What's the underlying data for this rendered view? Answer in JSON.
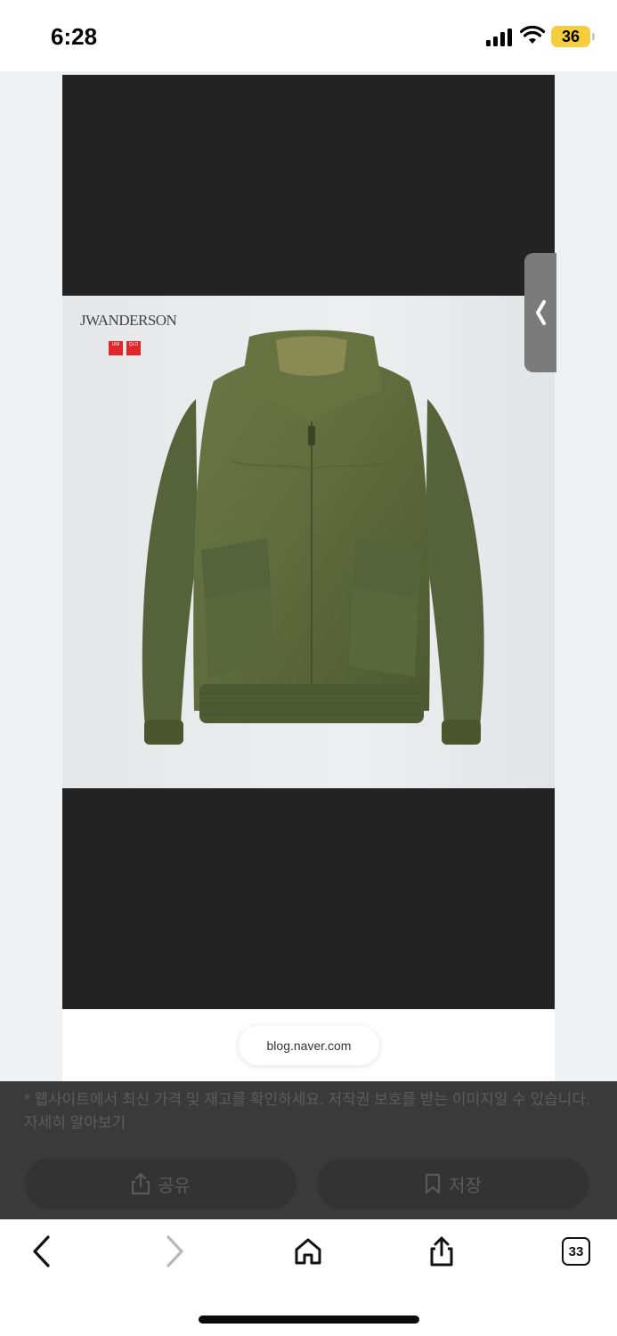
{
  "status": {
    "time": "6:28",
    "battery": "36"
  },
  "viewer": {
    "brand": "JWANDERSON",
    "uniqlo_logo": [
      "UNI",
      "QLO"
    ],
    "source": "blog.naver.com"
  },
  "overlay": {
    "disclaimer": "* 웹사이트에서 최신 가격 및 재고를 확인하세요. 저작권 보호를 받는 이미지일 수 있습니다. 자세히 알아보기",
    "share_label": "공유",
    "save_label": "저장"
  },
  "toolbar": {
    "tabs_count": "33"
  },
  "icons": {
    "back": "chevron-left-icon",
    "forward": "chevron-right-icon",
    "home": "home-icon",
    "share": "share-icon",
    "tabs": "tabs-icon"
  },
  "colors": {
    "battery": "#f6cd3c",
    "jacket": "#5f6b3c",
    "uniqlo_red": "#e0252b"
  }
}
